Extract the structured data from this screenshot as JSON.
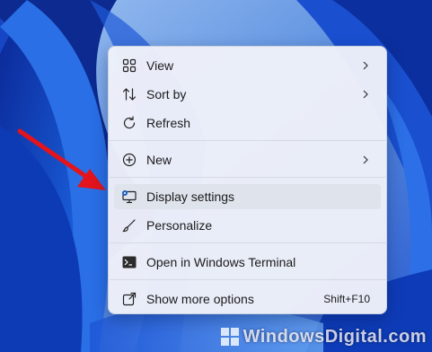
{
  "menu": {
    "items": [
      {
        "label": "View",
        "icon": "grid-icon",
        "submenu": true
      },
      {
        "label": "Sort by",
        "icon": "sort-icon",
        "submenu": true
      },
      {
        "label": "Refresh",
        "icon": "refresh-icon",
        "submenu": false
      },
      {
        "label": "New",
        "icon": "plus-circle-icon",
        "submenu": true
      },
      {
        "label": "Display settings",
        "icon": "display-icon",
        "submenu": false
      },
      {
        "label": "Personalize",
        "icon": "brush-icon",
        "submenu": false
      },
      {
        "label": "Open in Windows Terminal",
        "icon": "terminal-icon",
        "submenu": false
      },
      {
        "label": "Show more options",
        "icon": "expand-icon",
        "submenu": false,
        "shortcut": "Shift+F10"
      }
    ]
  },
  "watermark": {
    "text": "WindowsDigital.com"
  },
  "colors": {
    "wallpaper_dark": "#0a2fa8",
    "wallpaper_light": "#4a8ff0",
    "arrow": "#e3141b",
    "accent_icon": "#1a5fc4"
  }
}
